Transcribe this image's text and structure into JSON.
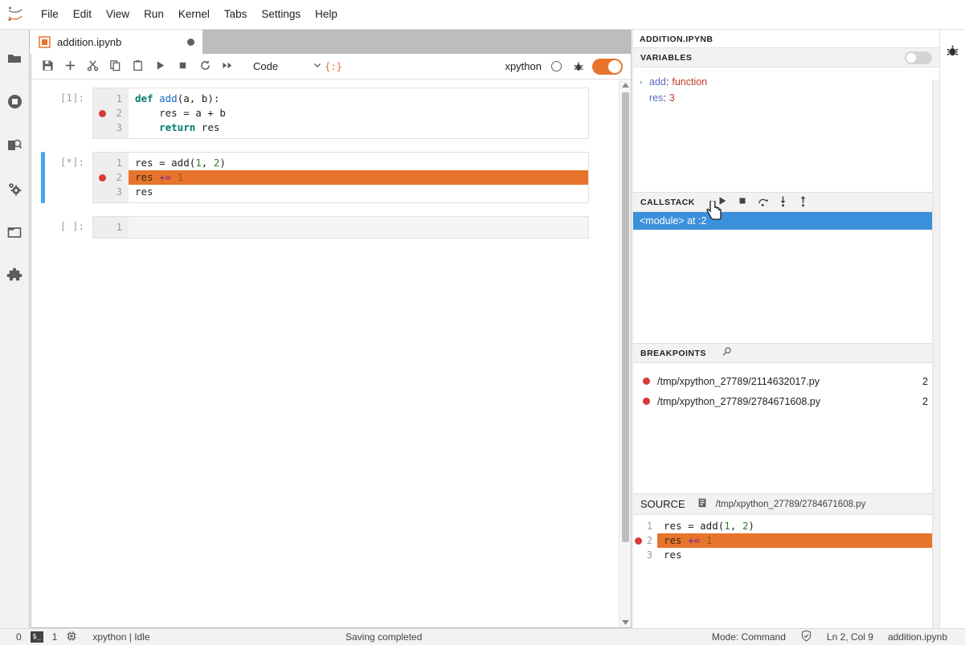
{
  "menubar": {
    "logo": "jupyter-logo",
    "items": [
      {
        "label": "File"
      },
      {
        "label": "Edit"
      },
      {
        "label": "View"
      },
      {
        "label": "Run"
      },
      {
        "label": "Kernel"
      },
      {
        "label": "Tabs"
      },
      {
        "label": "Settings"
      },
      {
        "label": "Help"
      }
    ]
  },
  "left_sidebar": {
    "items": [
      {
        "icon": "folder-icon",
        "name": "file-browser"
      },
      {
        "icon": "stop-circle-icon",
        "name": "running-terminals-kernels"
      },
      {
        "icon": "command-palette-icon",
        "name": "command-palette"
      },
      {
        "icon": "gears-icon",
        "name": "property-inspector"
      },
      {
        "icon": "window-icon",
        "name": "open-tabs"
      },
      {
        "icon": "puzzle-icon",
        "name": "extension-manager"
      }
    ]
  },
  "right_sidebar": {
    "items": [
      {
        "icon": "bug-icon",
        "name": "debugger"
      }
    ]
  },
  "notebook": {
    "tab": {
      "label": "addition.ipynb",
      "icon": "notebook-icon",
      "dirty": true
    },
    "toolbar": {
      "buttons": [
        {
          "name": "save-button",
          "icon": "save-icon"
        },
        {
          "name": "insert-cell-button",
          "icon": "plus-icon"
        },
        {
          "name": "cut-button",
          "icon": "scissors-icon"
        },
        {
          "name": "copy-button",
          "icon": "copy-icon"
        },
        {
          "name": "paste-button",
          "icon": "clipboard-icon"
        },
        {
          "name": "run-button",
          "icon": "play-icon"
        },
        {
          "name": "interrupt-button",
          "icon": "stop-icon"
        },
        {
          "name": "restart-button",
          "icon": "restart-icon"
        },
        {
          "name": "restart-run-all-button",
          "icon": "fast-forward-icon"
        }
      ],
      "cell_type": "Code",
      "cell_type_caret": "⌄",
      "debug_marker": "{:}",
      "kernel_name": "xpython",
      "debugger_enabled": true
    },
    "cells": [
      {
        "prompt": "[1]:",
        "active": false,
        "lines": [
          {
            "number": "1",
            "breakpoint": false,
            "highlight": false,
            "tokens": [
              {
                "t": "def ",
                "c": "kw"
              },
              {
                "t": "add",
                "c": "def"
              },
              {
                "t": "(a, b):",
                "c": "plain"
              }
            ]
          },
          {
            "number": "2",
            "breakpoint": true,
            "highlight": false,
            "tokens": [
              {
                "t": "    res = a + b",
                "c": "plain"
              }
            ]
          },
          {
            "number": "3",
            "breakpoint": false,
            "highlight": false,
            "tokens": [
              {
                "t": "    ",
                "c": "plain"
              },
              {
                "t": "return",
                "c": "kw"
              },
              {
                "t": " res",
                "c": "plain"
              }
            ]
          }
        ]
      },
      {
        "prompt": "[*]:",
        "active": true,
        "lines": [
          {
            "number": "1",
            "breakpoint": false,
            "highlight": false,
            "tokens": [
              {
                "t": "res = add(",
                "c": "plain"
              },
              {
                "t": "1",
                "c": "num"
              },
              {
                "t": ", ",
                "c": "plain"
              },
              {
                "t": "2",
                "c": "num"
              },
              {
                "t": ")",
                "c": "plain"
              }
            ]
          },
          {
            "number": "2",
            "breakpoint": true,
            "highlight": true,
            "tokens": [
              {
                "t": "res ",
                "c": "plain"
              },
              {
                "t": "+=",
                "c": "op"
              },
              {
                "t": " ",
                "c": "plain"
              },
              {
                "t": "1",
                "c": "num"
              }
            ]
          },
          {
            "number": "3",
            "breakpoint": false,
            "highlight": false,
            "tokens": [
              {
                "t": "res",
                "c": "plain"
              }
            ]
          }
        ]
      },
      {
        "prompt": "[ ]:",
        "active": false,
        "empty": true,
        "lines": [
          {
            "number": "1",
            "breakpoint": false,
            "highlight": false,
            "tokens": [
              {
                "t": "",
                "c": "plain"
              }
            ]
          }
        ]
      }
    ]
  },
  "debugger": {
    "title": "ADDITION.IPYNB",
    "variables": {
      "header": "VARIABLES",
      "toggle_on": false,
      "rows": [
        {
          "caret": "›",
          "name": "add",
          "colon": ":",
          "value": "function",
          "indent": false
        },
        {
          "caret": "",
          "name": "res",
          "colon": ":",
          "value": "3",
          "indent": true
        }
      ]
    },
    "callstack": {
      "header": "CALLSTACK",
      "buttons": [
        {
          "name": "continue-button",
          "icon": "play-icon"
        },
        {
          "name": "terminate-button",
          "icon": "stop-icon"
        },
        {
          "name": "step-over-button",
          "icon": "step-over-icon"
        },
        {
          "name": "step-in-button",
          "icon": "step-in-icon"
        },
        {
          "name": "step-out-button",
          "icon": "step-out-icon"
        }
      ],
      "frames": [
        {
          "label": "<module> at :2",
          "selected": true
        }
      ]
    },
    "breakpoints": {
      "header": "BREAKPOINTS",
      "pin_icon": "pin-icon",
      "rows": [
        {
          "file": "/tmp/xpython_27789/2114632017.py",
          "line": "2"
        },
        {
          "file": "/tmp/xpython_27789/2784671608.py",
          "line": "2"
        }
      ]
    },
    "source": {
      "header": "SOURCE",
      "open_icon": "open-in-editor-icon",
      "path": "/tmp/xpython_27789/2784671608.py",
      "lines": [
        {
          "number": "1",
          "breakpoint": false,
          "highlight": false,
          "tokens": [
            {
              "t": "res = add(",
              "c": "plain"
            },
            {
              "t": "1",
              "c": "num"
            },
            {
              "t": ", ",
              "c": "plain"
            },
            {
              "t": "2",
              "c": "num"
            },
            {
              "t": ")",
              "c": "plain"
            }
          ]
        },
        {
          "number": "2",
          "breakpoint": true,
          "highlight": true,
          "tokens": [
            {
              "t": "res ",
              "c": "plain"
            },
            {
              "t": "+=",
              "c": "op"
            },
            {
              "t": " ",
              "c": "plain"
            },
            {
              "t": "1",
              "c": "num"
            }
          ]
        },
        {
          "number": "3",
          "breakpoint": false,
          "highlight": false,
          "tokens": [
            {
              "t": "res",
              "c": "plain"
            }
          ]
        }
      ]
    }
  },
  "statusbar": {
    "terminal_count": "0",
    "terminal_icon": "terminal-icon",
    "kernel_count": "1",
    "kernel_icon": "cpu-icon",
    "kernel_status": "xpython | Idle",
    "message": "Saving completed",
    "mode": "Mode: Command",
    "trust_icon": "shield-check-icon",
    "position": "Ln 2, Col 9",
    "filename": "addition.ipynb"
  },
  "colors": {
    "accent_orange": "#e8742c",
    "selection_blue": "#3b90db",
    "breakpoint_red": "#d63a3a",
    "active_cell_blue": "#42a5f5"
  }
}
